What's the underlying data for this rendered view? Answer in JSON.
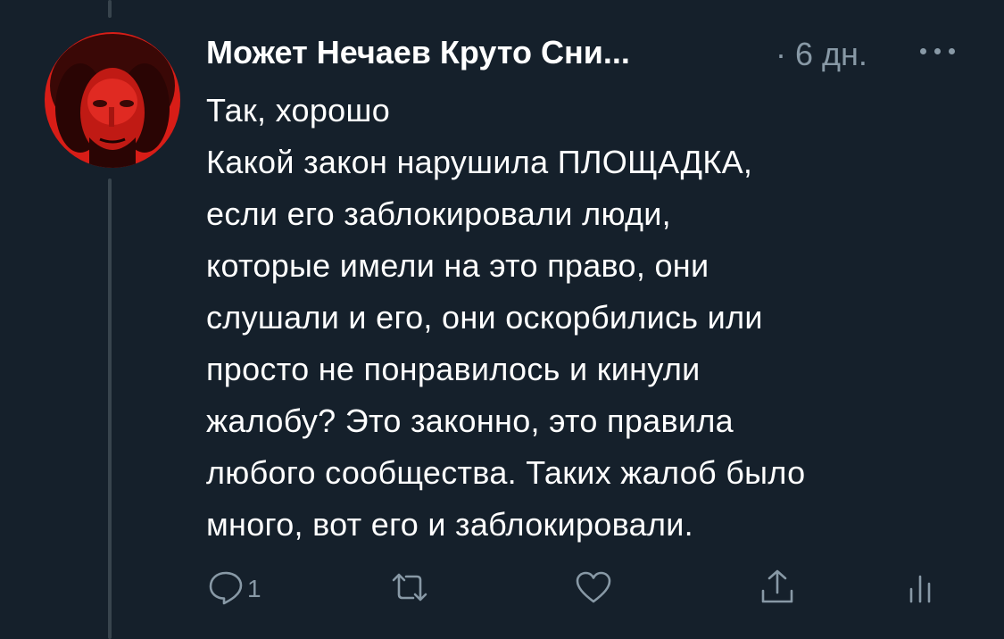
{
  "tweet": {
    "author_display_name": "Может Нечаев Круто Сни...",
    "meta_separator": "·",
    "time_ago": "6 дн.",
    "text": "Так, хорошо\nКакой закон нарушила ПЛОЩАДКА,\nесли его заблокировали люди,\nкоторые имели на это право, они\nслушали и его, они оскорбились или\nпросто не понравилось и кинули\nжалобу? Это законно, это правила\nлюбого сообщества. Таких жалоб было\nмного, вот его и заблокировали.",
    "reply_count": "1"
  },
  "actions": [
    {
      "name": "reply",
      "icon": "reply-icon"
    },
    {
      "name": "retweet",
      "icon": "retweet-icon"
    },
    {
      "name": "like",
      "icon": "heart-icon"
    },
    {
      "name": "share",
      "icon": "share-icon"
    },
    {
      "name": "analytics",
      "icon": "analytics-icon"
    }
  ],
  "colors": {
    "background": "#15202b",
    "text_primary": "#ffffff",
    "text_secondary": "#8899a6",
    "thread_line": "#38444d",
    "avatar_tint": "#e0201a"
  }
}
